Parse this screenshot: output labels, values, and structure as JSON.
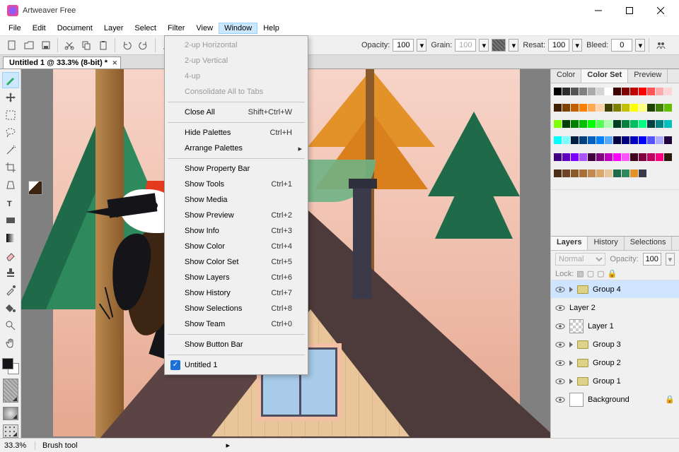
{
  "app": {
    "title": "Artweaver Free"
  },
  "menubar": [
    "File",
    "Edit",
    "Document",
    "Layer",
    "Select",
    "Filter",
    "View",
    "Window",
    "Help"
  ],
  "menubar_active_index": 7,
  "toolbar_opts": {
    "opacity_label": "Opacity:",
    "opacity": "100",
    "grain_label": "Grain:",
    "grain": "100",
    "resat_label": "Resat:",
    "resat": "100",
    "bleed_label": "Bleed:",
    "bleed": "0"
  },
  "doc_tab": "Untitled 1 @ 33.3% (8-bit) *",
  "window_menu": [
    {
      "label": "2-up Horizontal",
      "disabled": true
    },
    {
      "label": "2-up Vertical",
      "disabled": true
    },
    {
      "label": "4-up",
      "disabled": true
    },
    {
      "label": "Consolidate All to Tabs",
      "disabled": true
    },
    {
      "sep": true
    },
    {
      "label": "Close All",
      "shortcut": "Shift+Ctrl+W"
    },
    {
      "sep": true
    },
    {
      "label": "Hide Palettes",
      "shortcut": "Ctrl+H"
    },
    {
      "label": "Arrange Palettes",
      "submenu": true
    },
    {
      "sep": true
    },
    {
      "label": "Show Property Bar"
    },
    {
      "label": "Show Tools",
      "shortcut": "Ctrl+1"
    },
    {
      "label": "Show Media"
    },
    {
      "label": "Show Preview",
      "shortcut": "Ctrl+2"
    },
    {
      "label": "Show Info",
      "shortcut": "Ctrl+3"
    },
    {
      "label": "Show Color",
      "shortcut": "Ctrl+4"
    },
    {
      "label": "Show Color Set",
      "shortcut": "Ctrl+5"
    },
    {
      "label": "Show Layers",
      "shortcut": "Ctrl+6"
    },
    {
      "label": "Show History",
      "shortcut": "Ctrl+7"
    },
    {
      "label": "Show Selections",
      "shortcut": "Ctrl+8"
    },
    {
      "label": "Show Team",
      "shortcut": "Ctrl+0"
    },
    {
      "sep": true
    },
    {
      "label": "Show Button Bar"
    },
    {
      "sep": true
    },
    {
      "label": "Untitled 1",
      "checked": true
    }
  ],
  "color_tabs": [
    "Color",
    "Color Set",
    "Preview"
  ],
  "color_tabs_active": 1,
  "layer_tabs": [
    "Layers",
    "History",
    "Selections"
  ],
  "layer_tabs_active": 0,
  "layer_opts": {
    "blend": "Normal",
    "opacity_label": "Opacity:",
    "opacity": "100",
    "lock_label": "Lock:"
  },
  "layers": [
    {
      "name": "Group 4",
      "type": "group",
      "selected": true
    },
    {
      "name": "Layer 2",
      "type": "layer",
      "thumb": "bird"
    },
    {
      "name": "Layer 1",
      "type": "layer",
      "thumb": "checker"
    },
    {
      "name": "Group 3",
      "type": "group"
    },
    {
      "name": "Group 2",
      "type": "group"
    },
    {
      "name": "Group 1",
      "type": "group"
    },
    {
      "name": "Background",
      "type": "bg",
      "locked": true
    }
  ],
  "status": {
    "zoom": "33.3%",
    "tool": "Brush tool"
  },
  "palette_colors": [
    "#000",
    "#2b2b2b",
    "#555",
    "#808080",
    "#aaa",
    "#d4d4d4",
    "#fff",
    "#400000",
    "#800000",
    "#c00000",
    "#ff0000",
    "#ff5555",
    "#ffaaaa",
    "#ffd4d4",
    "#402000",
    "#804000",
    "#c06000",
    "#ff8000",
    "#ffaa55",
    "#ffd4aa",
    "#404000",
    "#808000",
    "#c0c000",
    "#ffff00",
    "#ffff80",
    "#204000",
    "#408000",
    "#60c000",
    "#80ff00",
    "#004000",
    "#008000",
    "#00c000",
    "#00ff00",
    "#55ff55",
    "#aaffaa",
    "#004020",
    "#008040",
    "#00c060",
    "#00ff80",
    "#004040",
    "#008080",
    "#00c0c0",
    "#00ffff",
    "#80ffff",
    "#002040",
    "#004080",
    "#0060c0",
    "#0080ff",
    "#55aaff",
    "#000040",
    "#000080",
    "#0000c0",
    "#0000ff",
    "#5555ff",
    "#aaaaff",
    "#200040",
    "#400080",
    "#6000c0",
    "#8000ff",
    "#aa55ff",
    "#400040",
    "#800080",
    "#c000c0",
    "#ff00ff",
    "#ff55ff",
    "#400020",
    "#800040",
    "#c00060",
    "#ff0080",
    "#2b1a0e",
    "#4d2f1a",
    "#6f4426",
    "#8a5a2a",
    "#a77038",
    "#c08a52",
    "#d9a86e",
    "#e9c59a",
    "#1f6b49",
    "#2e8a5c",
    "#e3922a",
    "#3a3a4a"
  ]
}
